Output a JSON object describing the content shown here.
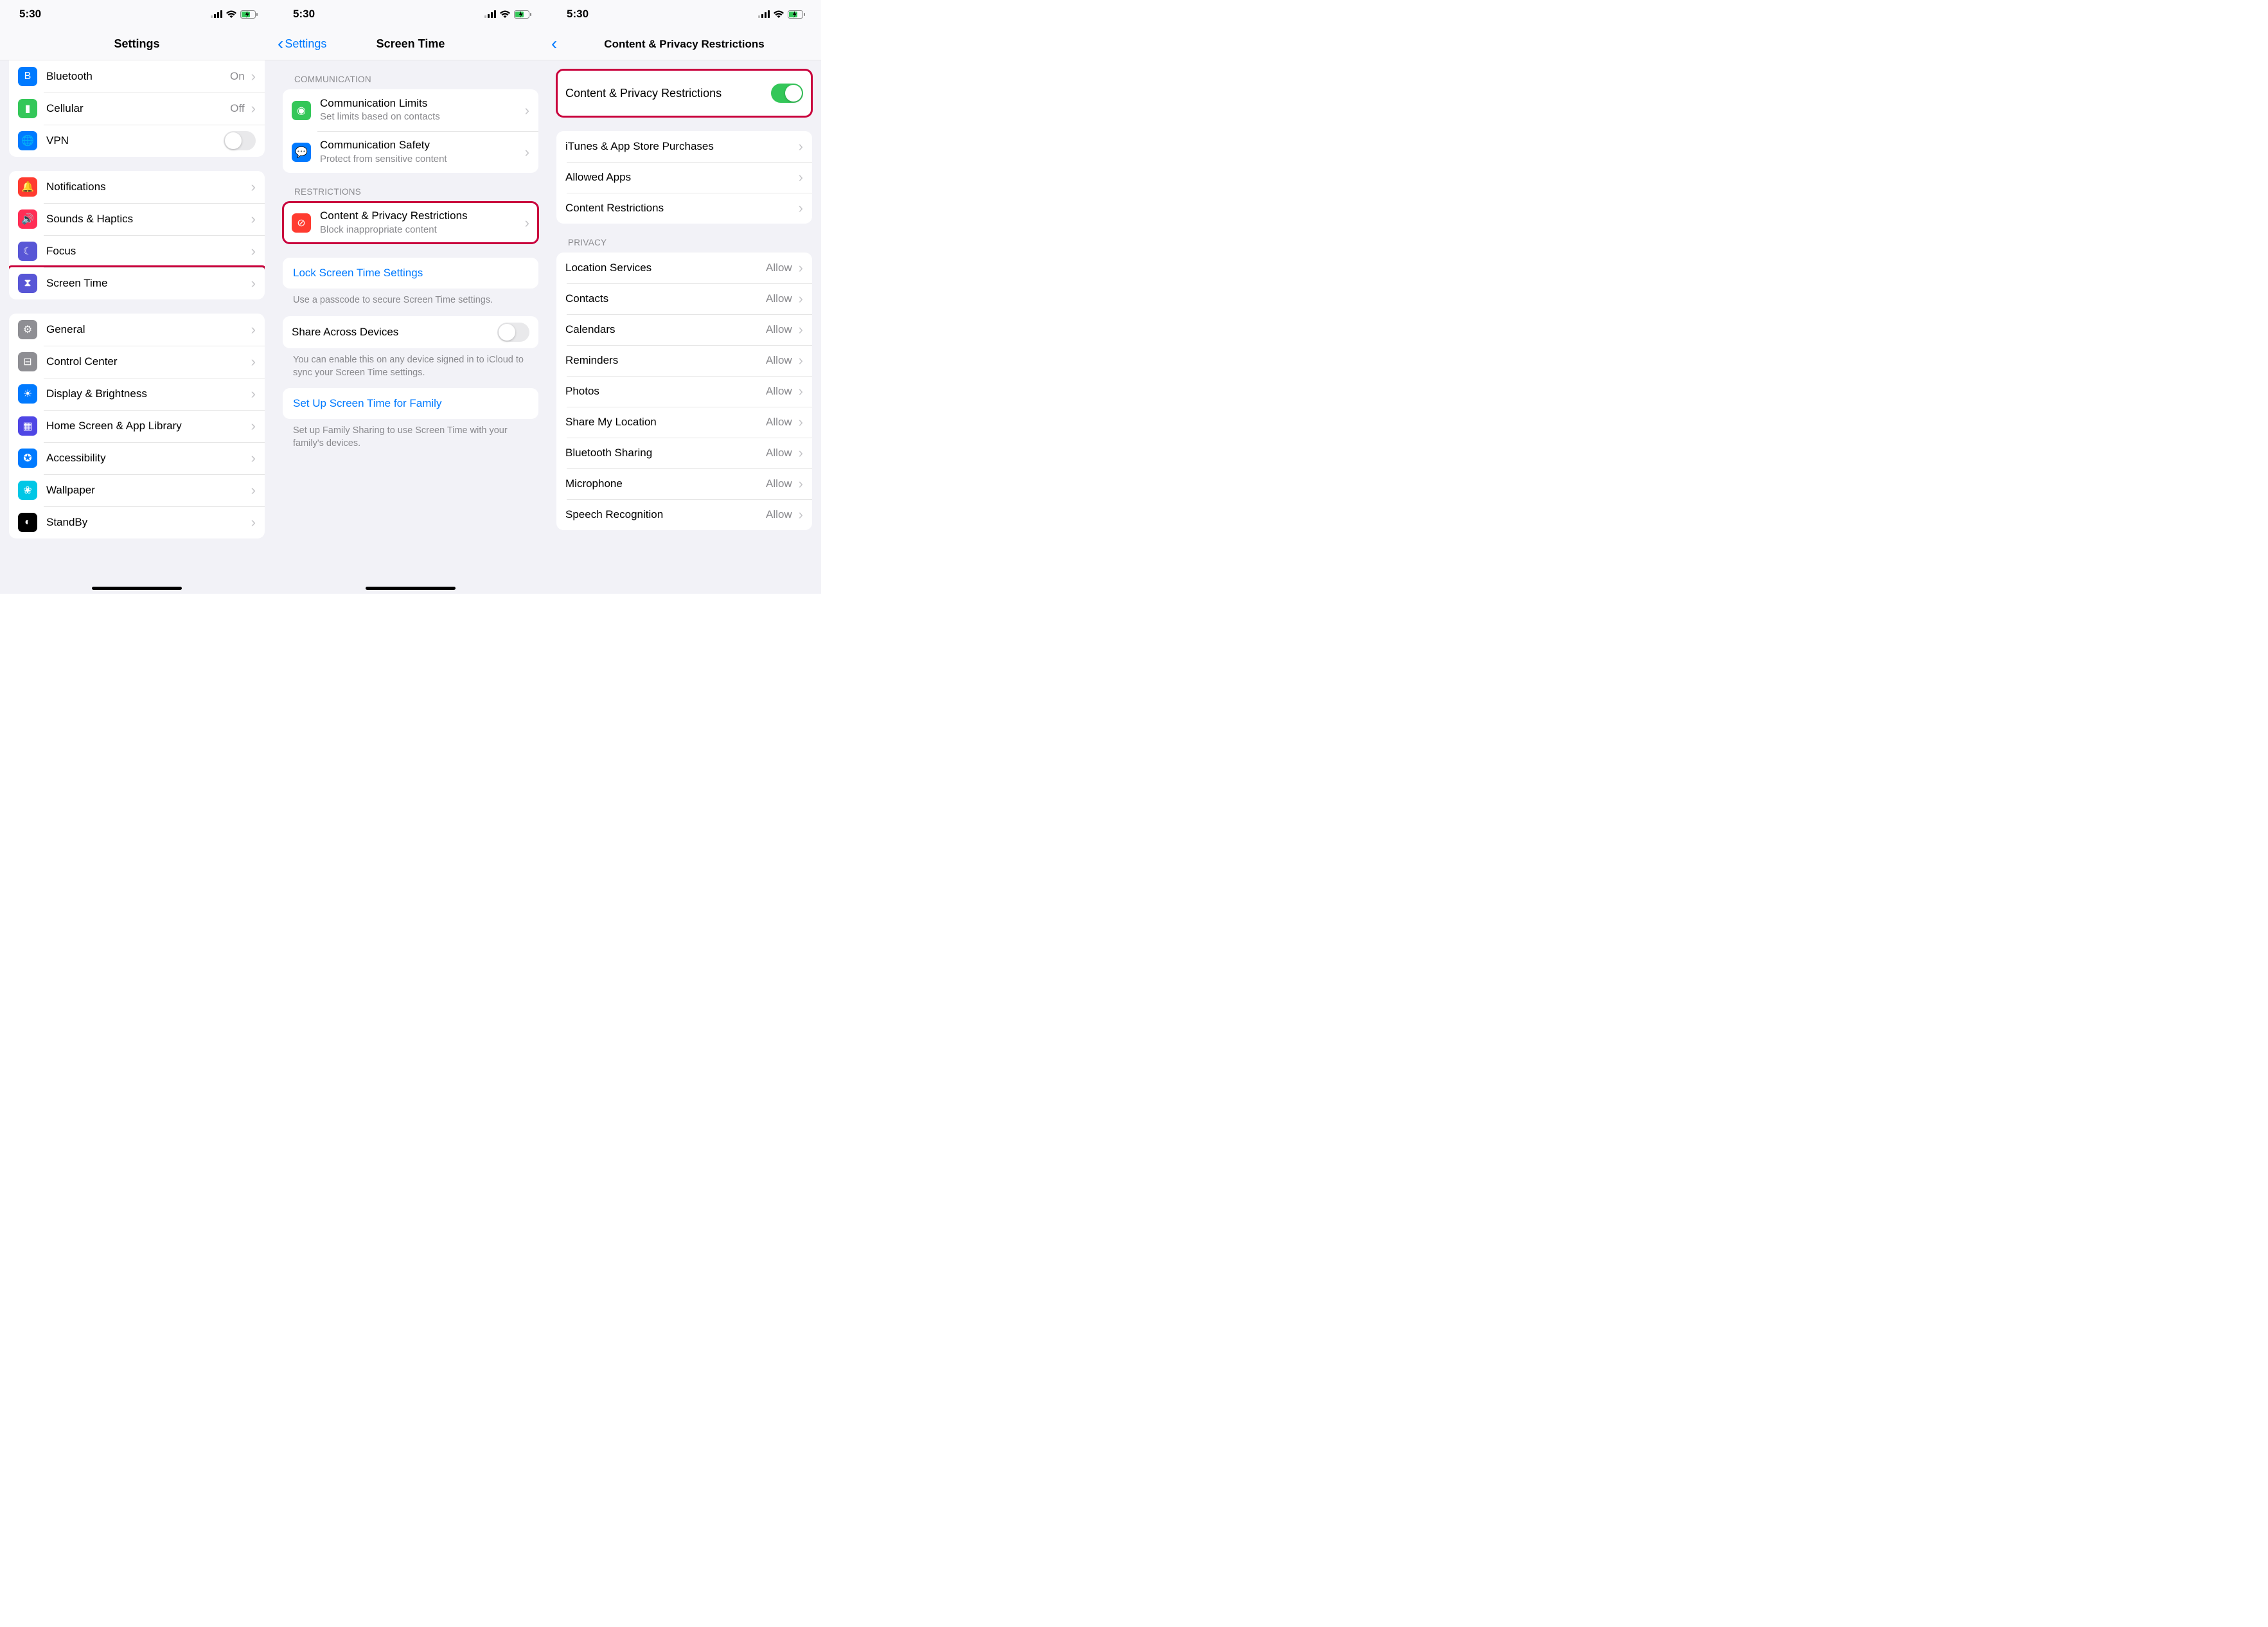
{
  "status": {
    "time": "5:30"
  },
  "col1": {
    "title": "Settings",
    "group1": [
      {
        "icon": "bluetooth",
        "bg": "#007aff",
        "label": "Bluetooth",
        "value": "On"
      },
      {
        "icon": "cellular",
        "bg": "#34c759",
        "label": "Cellular",
        "value": "Off"
      },
      {
        "icon": "vpn",
        "bg": "#007aff",
        "label": "VPN",
        "toggle": false
      }
    ],
    "group2": [
      {
        "icon": "notifications",
        "bg": "#ff3b30",
        "label": "Notifications"
      },
      {
        "icon": "sounds",
        "bg": "#ff2d55",
        "label": "Sounds & Haptics"
      },
      {
        "icon": "focus",
        "bg": "#5856d6",
        "label": "Focus"
      },
      {
        "icon": "screentime",
        "bg": "#5856d6",
        "label": "Screen Time",
        "highlight": true
      }
    ],
    "group3": [
      {
        "icon": "general",
        "bg": "#8e8e93",
        "label": "General"
      },
      {
        "icon": "controlcenter",
        "bg": "#8e8e93",
        "label": "Control Center"
      },
      {
        "icon": "display",
        "bg": "#007aff",
        "label": "Display & Brightness"
      },
      {
        "icon": "homescreen",
        "bg": "#4f46e5",
        "label": "Home Screen & App Library"
      },
      {
        "icon": "accessibility",
        "bg": "#007aff",
        "label": "Accessibility"
      },
      {
        "icon": "wallpaper",
        "bg": "#00c7e6",
        "label": "Wallpaper"
      },
      {
        "icon": "standby",
        "bg": "#000000",
        "label": "StandBy"
      }
    ]
  },
  "col2": {
    "back": "Settings",
    "title": "Screen Time",
    "sections": {
      "communication": "COMMUNICATION",
      "restrictions": "RESTRICTIONS"
    },
    "comm_rows": [
      {
        "icon": "comm-limits",
        "bg": "#34c759",
        "title": "Communication Limits",
        "sub": "Set limits based on contacts"
      },
      {
        "icon": "comm-safety",
        "bg": "#007aff",
        "title": "Communication Safety",
        "sub": "Protect from sensitive content"
      }
    ],
    "restrict_row": {
      "icon": "prohibit",
      "bg": "#ff3b30",
      "title": "Content & Privacy Restrictions",
      "sub": "Block inappropriate content"
    },
    "lock_link": "Lock Screen Time Settings",
    "lock_note": "Use a passcode to secure Screen Time settings.",
    "share_label": "Share Across Devices",
    "share_note": "You can enable this on any device signed in to iCloud to sync your Screen Time settings.",
    "family_link": "Set Up Screen Time for Family",
    "family_note": "Set up Family Sharing to use Screen Time with your family's devices."
  },
  "col3": {
    "title": "Content & Privacy Restrictions",
    "master_toggle_label": "Content & Privacy Restrictions",
    "group1": [
      {
        "label": "iTunes & App Store Purchases"
      },
      {
        "label": "Allowed Apps"
      },
      {
        "label": "Content Restrictions"
      }
    ],
    "privacy_header": "PRIVACY",
    "privacy": [
      {
        "label": "Location Services",
        "value": "Allow"
      },
      {
        "label": "Contacts",
        "value": "Allow"
      },
      {
        "label": "Calendars",
        "value": "Allow"
      },
      {
        "label": "Reminders",
        "value": "Allow"
      },
      {
        "label": "Photos",
        "value": "Allow"
      },
      {
        "label": "Share My Location",
        "value": "Allow"
      },
      {
        "label": "Bluetooth Sharing",
        "value": "Allow"
      },
      {
        "label": "Microphone",
        "value": "Allow"
      },
      {
        "label": "Speech Recognition",
        "value": "Allow"
      }
    ]
  },
  "icons": {
    "bluetooth": "B",
    "cellular": "▮",
    "vpn": "🌐",
    "notifications": "🔔",
    "sounds": "🔊",
    "focus": "☾",
    "screentime": "⧗",
    "general": "⚙︎",
    "controlcenter": "⊟",
    "display": "☀︎",
    "homescreen": "▦",
    "accessibility": "✪",
    "wallpaper": "❀",
    "standby": "◐",
    "comm-limits": "◉",
    "comm-safety": "💬",
    "prohibit": "⊘"
  }
}
